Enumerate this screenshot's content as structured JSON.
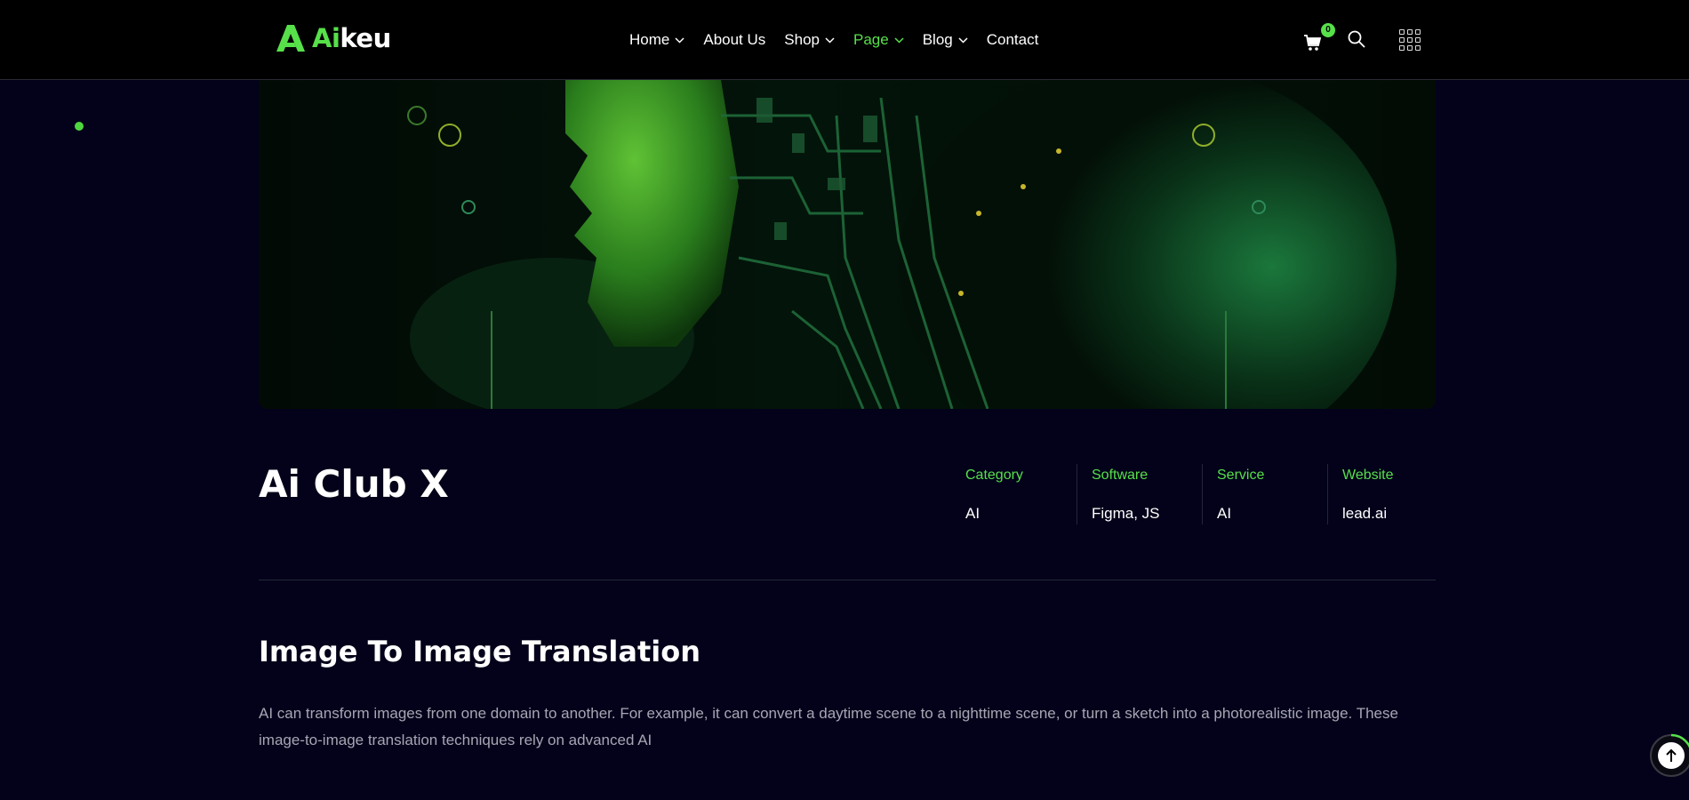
{
  "header": {
    "logo": {
      "brand_highlight": "Ai",
      "brand_rest": "keu"
    },
    "nav": [
      {
        "label": "Home",
        "dropdown": true,
        "active": false
      },
      {
        "label": "About Us",
        "dropdown": false,
        "active": false
      },
      {
        "label": "Shop",
        "dropdown": true,
        "active": false
      },
      {
        "label": "Page",
        "dropdown": true,
        "active": true
      },
      {
        "label": "Blog",
        "dropdown": true,
        "active": false
      },
      {
        "label": "Contact",
        "dropdown": false,
        "active": false
      }
    ],
    "cart_count": "0",
    "icons": [
      "cart-icon",
      "search-icon",
      "grid-menu-icon"
    ]
  },
  "project": {
    "title": "Ai Club X",
    "meta": [
      {
        "label": "Category",
        "value": "AI"
      },
      {
        "label": "Software",
        "value": "Figma, JS"
      },
      {
        "label": "Service",
        "value": "AI"
      },
      {
        "label": "Website",
        "value": "lead.ai"
      }
    ]
  },
  "section": {
    "title": "Image To Image Translation",
    "body": "AI can transform images from one domain to another. For example, it can convert a daytime scene to a nighttime scene, or turn a sketch into a photorealistic image. These image-to-image translation techniques rely on advanced AI"
  },
  "colors": {
    "accent": "#57e04a",
    "background": "#03021a",
    "header": "#000000",
    "muted_text": "#a6a6b4"
  }
}
